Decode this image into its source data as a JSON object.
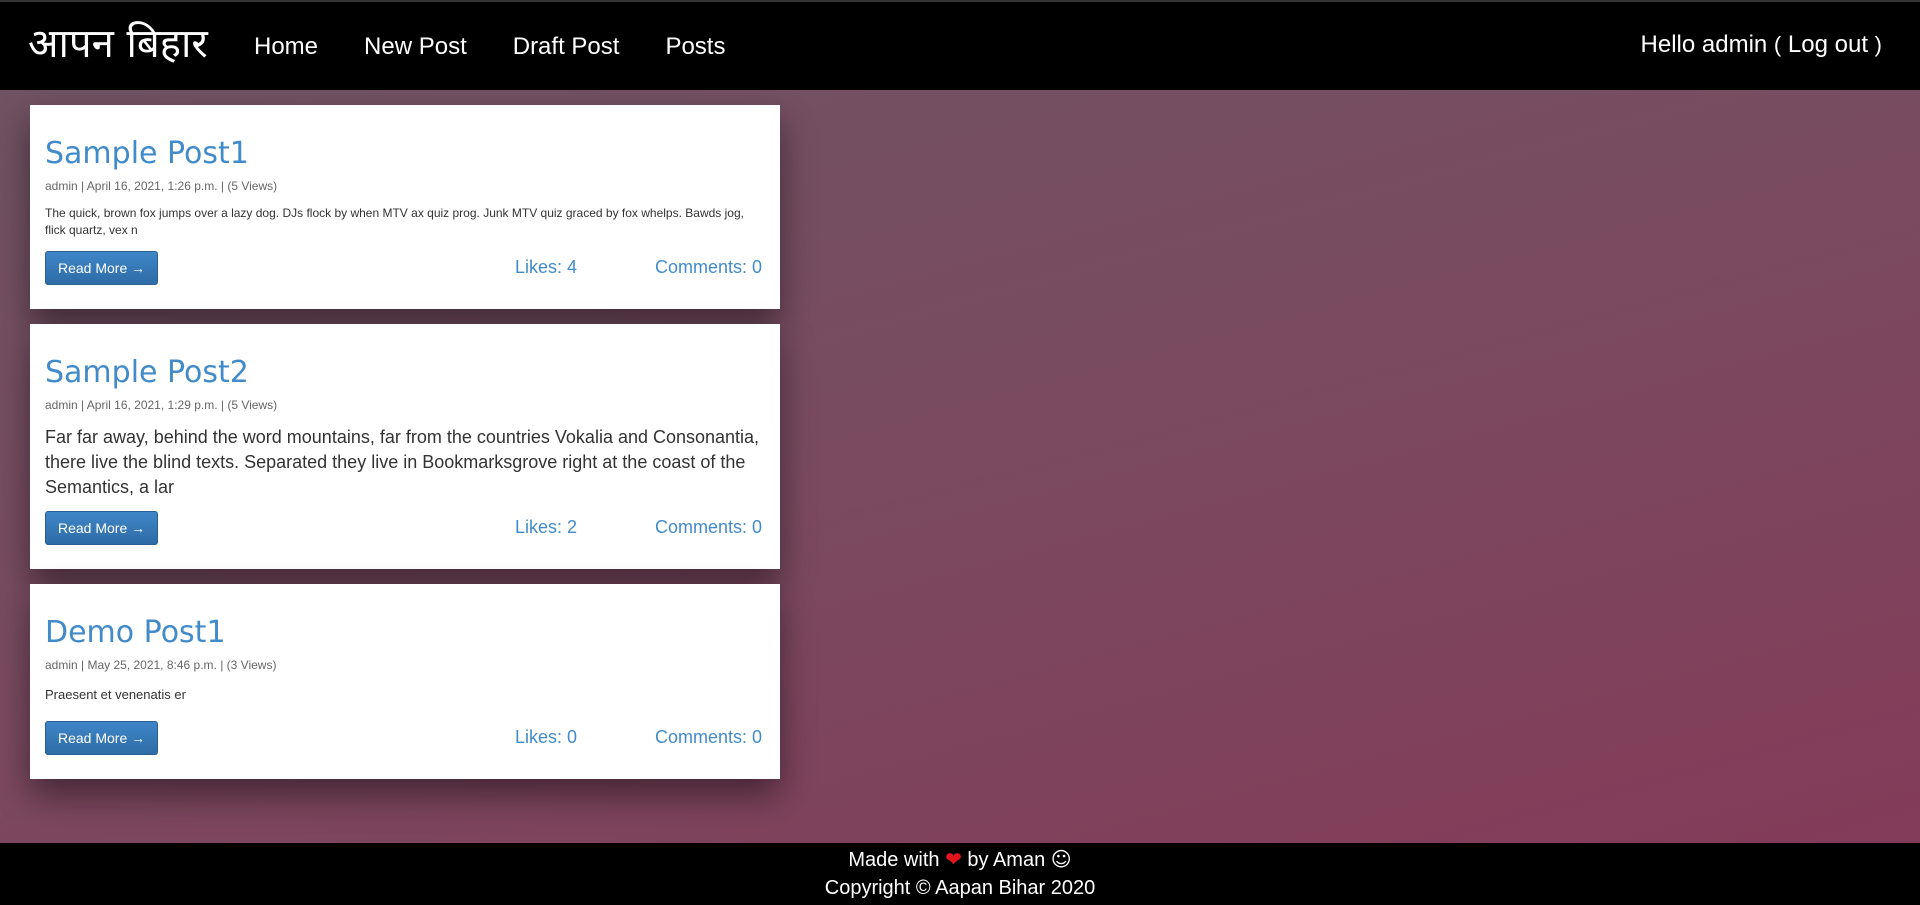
{
  "navbar": {
    "brand": "आपन बिहार",
    "links": [
      "Home",
      "New Post",
      "Draft Post",
      "Posts"
    ],
    "greeting": "Hello admin",
    "paren_open": "(",
    "logout": "Log out",
    "paren_close": ")"
  },
  "posts": [
    {
      "title": "Sample Post1",
      "meta": "admin | April 16, 2021, 1:26 p.m. | (5 Views)",
      "excerpt": "The quick, brown fox jumps over a lazy dog. DJs flock by when MTV ax quiz prog. Junk MTV quiz graced by fox whelps. Bawds jog, flick quartz, vex n",
      "read_more": "Read More →",
      "likes": "Likes: 4",
      "comments": "Comments: 0"
    },
    {
      "title": "Sample Post2",
      "meta": "admin | April 16, 2021, 1:29 p.m. | (5 Views)",
      "excerpt": "Far far away, behind the word mountains, far from the countries Vokalia and Consonantia, there live the blind texts. Separated they live in Bookmarksgrove right at the coast of the Semantics, a lar",
      "read_more": "Read More →",
      "likes": "Likes: 2",
      "comments": "Comments: 0"
    },
    {
      "title": "Demo Post1",
      "meta": "admin | May 25, 2021, 8:46 p.m. | (3 Views)",
      "excerpt": "Praesent et venenatis er",
      "read_more": "Read More →",
      "likes": "Likes: 0",
      "comments": "Comments: 0"
    }
  ],
  "footer": {
    "made_with": "Made with",
    "heart_glyph": "❤",
    "by": "by Aman",
    "smile_glyph": "☺",
    "copyright": "Copyright © Aapan Bihar 2020"
  },
  "colors": {
    "link": "#428bca",
    "navbar_bg": "#000000",
    "button": "#337ab7",
    "heart": "#e3141d"
  }
}
